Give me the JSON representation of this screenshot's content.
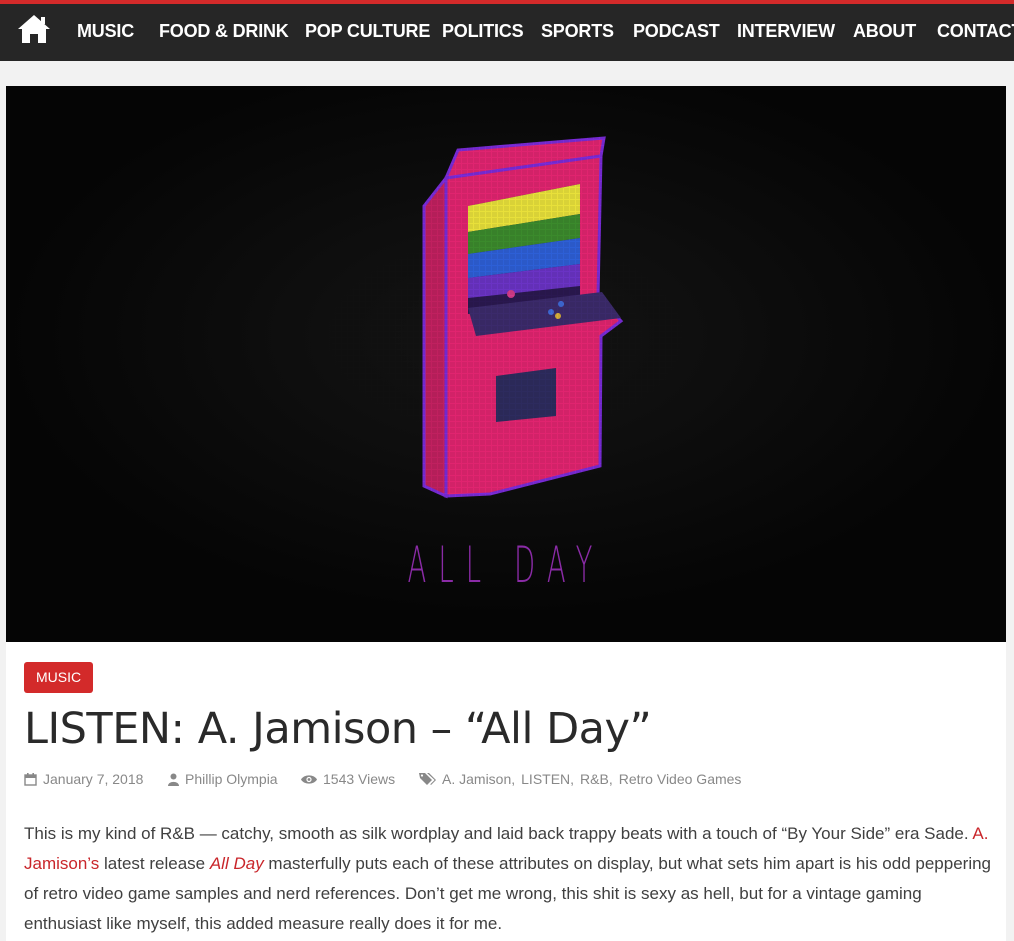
{
  "nav": {
    "items": [
      "MUSIC",
      "FOOD & DRINK",
      "POP CULTURE",
      "POLITICS",
      "SPORTS",
      "PODCAST",
      "INTERVIEW",
      "ABOUT",
      "CONTACT"
    ]
  },
  "hero": {
    "title": "ALL DAY"
  },
  "post": {
    "category": "MUSIC",
    "title": "LISTEN: A. Jamison – “All Day”",
    "date": "January 7, 2018",
    "author": "Phillip Olympia",
    "views": "1543 Views",
    "tags": [
      "A. Jamison",
      "LISTEN",
      "R&B",
      "Retro Video Games"
    ],
    "tag_separator": ",",
    "body": {
      "p1": "This is my kind of R&B — catchy, smooth as silk wordplay and laid back trappy beats with a touch of “By Your Side” era Sade. ",
      "link_artist": "A. Jamison’s",
      "p2": " latest release ",
      "link_release": "All Day",
      "p3": " masterfully puts each of these attributes on display, but what sets him apart is his odd peppering of retro video game samples and nerd references. Don’t get me wrong, this shit is sexy as hell, but for a vintage gaming enthusiast like myself, this added measure really does it for me."
    }
  },
  "colors": {
    "accent": "#d32a2a",
    "nav_bg": "#262626",
    "link": "#c9262b"
  },
  "icons": [
    "home-icon",
    "calendar-icon",
    "user-icon",
    "eye-icon",
    "tags-icon"
  ]
}
